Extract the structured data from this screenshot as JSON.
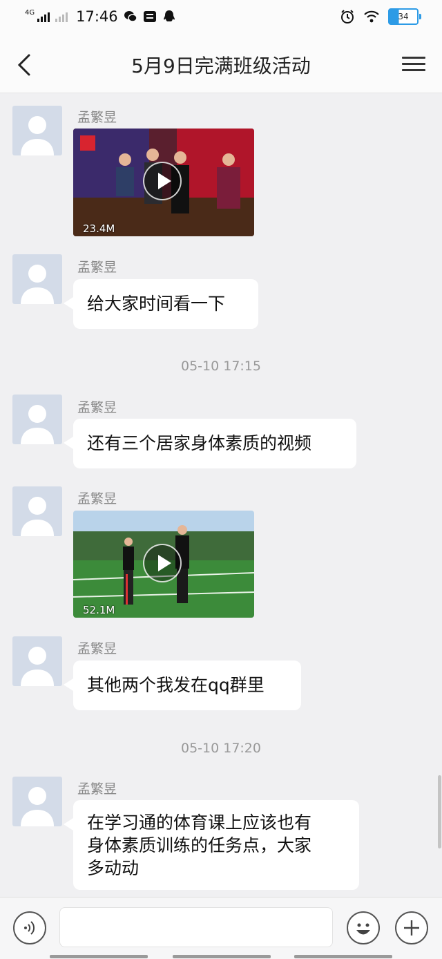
{
  "status_bar": {
    "network": "4G",
    "time": "17:46",
    "battery": "34"
  },
  "header": {
    "title": "5月9日完满班级活动"
  },
  "messages": [
    {
      "type": "video",
      "sender": "孟繁昱",
      "size": "23.4M"
    },
    {
      "type": "text",
      "sender": "孟繁昱",
      "text": "给大家时间看一下"
    },
    {
      "type": "timestamp",
      "text": "05-10 17:15"
    },
    {
      "type": "text",
      "sender": "孟繁昱",
      "text": "还有三个居家身体素质的视频"
    },
    {
      "type": "video",
      "sender": "孟繁昱",
      "size": "52.1M"
    },
    {
      "type": "text",
      "sender": "孟繁昱",
      "text": "其他两个我发在qq群里"
    },
    {
      "type": "timestamp",
      "text": "05-10 17:20"
    },
    {
      "type": "text",
      "sender": "孟繁昱",
      "lines": [
        "在学习通的体育课上应该也有",
        "身体素质训练的任务点，大家",
        "多动动"
      ]
    }
  ],
  "input_bar": {
    "placeholder": "",
    "icons": [
      "voice-icon",
      "emoji-icon",
      "plus-icon"
    ]
  },
  "colors": {
    "background": "#f0f0f2",
    "bubble": "#ffffff",
    "avatar": "#d3dbe8",
    "battery": "#2d9be6"
  }
}
